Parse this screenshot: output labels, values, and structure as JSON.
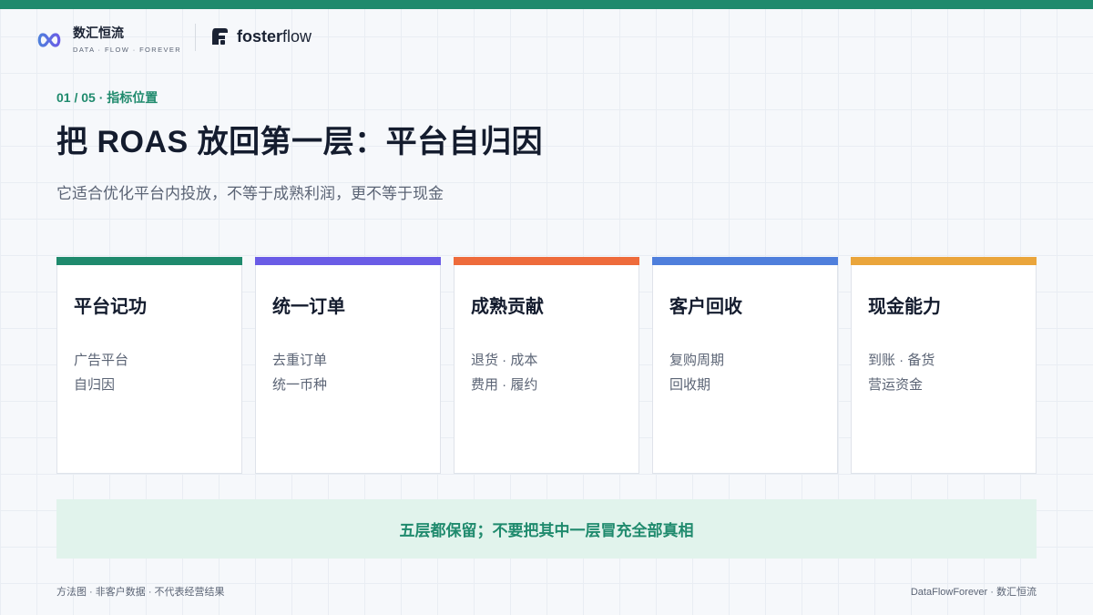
{
  "brand": {
    "name": "数汇恒流",
    "tagline": "DATA · FLOW · FOREVER",
    "partner_bold": "foster",
    "partner_light": "flow"
  },
  "header": {
    "eyebrow": "01 / 05 · 指标位置",
    "title": "把 ROAS 放回第一层：平台自归因",
    "subtitle": "它适合优化平台内投放，不等于成熟利润，更不等于现金"
  },
  "cards": [
    {
      "title": "平台记功",
      "lines": [
        "广告平台",
        "自归因"
      ],
      "color": "#1f8a6d"
    },
    {
      "title": "统一订单",
      "lines": [
        "去重订单",
        "统一币种"
      ],
      "color": "#6a5ce6"
    },
    {
      "title": "成熟贡献",
      "lines": [
        "退货 · 成本",
        "费用 · 履约"
      ],
      "color": "#ee6b3b"
    },
    {
      "title": "客户回收",
      "lines": [
        "复购周期",
        "回收期"
      ],
      "color": "#4f7fdc"
    },
    {
      "title": "现金能力",
      "lines": [
        "到账 · 备货",
        "营运资金"
      ],
      "color": "#eaa53b"
    }
  ],
  "callout": {
    "text": "五层都保留；不要把其中一层冒充全部真相"
  },
  "footer": {
    "left": "方法图 · 非客户数据 · 不代表经营结果",
    "right": "DataFlowForever · 数汇恒流"
  },
  "colors": {
    "accent": "#1f8a6d",
    "callout_bg": "#e1f3ec"
  }
}
